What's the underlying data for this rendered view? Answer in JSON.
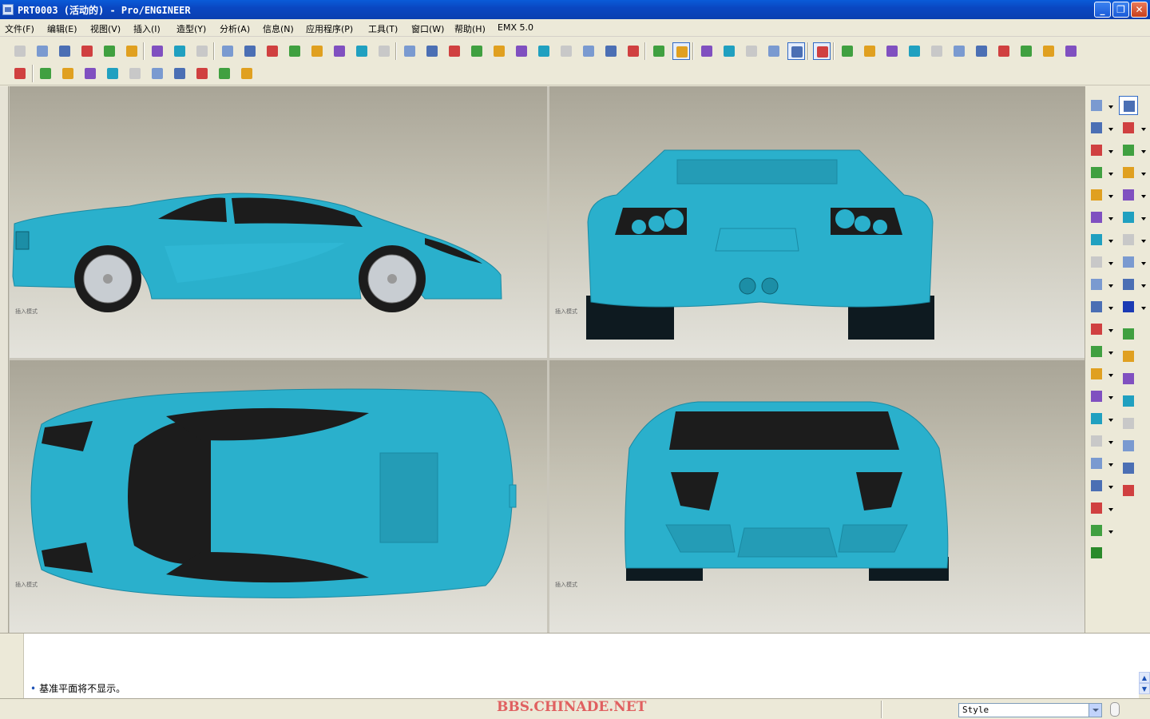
{
  "window": {
    "title": "PRT0003 (活动的) - Pro/ENGINEER",
    "controls": [
      "minimize",
      "maximize",
      "close"
    ]
  },
  "menu": {
    "items": [
      "文件(F)",
      "编辑(E)",
      "视图(V)",
      "插入(I)",
      "造型(Y)",
      "分析(A)",
      "信息(N)",
      "应用程序(P)",
      "工具(T)",
      "窗口(W)",
      "帮助(H)",
      "EMX 5.0"
    ]
  },
  "toolbars": {
    "row1_icons": [
      "new-icon",
      "open-icon",
      "save-icon",
      "print-icon",
      "send-icon",
      "mail-icon",
      "undo-icon",
      "redo-icon",
      "regenerate-icon",
      "cut-icon",
      "copy-icon",
      "paste-icon",
      "paste-special-icon",
      "model-player-icon",
      "find-icon",
      "selection-box-icon",
      "repaint-icon",
      "spin-center-icon",
      "orient-icon",
      "zoom-in-icon",
      "zoom-out-icon",
      "refit-icon",
      "reorient-icon",
      "saved-views-icon",
      "layers-icon",
      "view-manager-icon",
      "wireframe-icon",
      "hidden-line-icon",
      "no-hidden-icon",
      "shading-icon",
      "datum-planes-icon",
      "datum-axes-icon",
      "datum-points-icon",
      "coordinate-systems-icon",
      "annotation-icon",
      "four-view-icon",
      "curvature-icon",
      "section-icon",
      "offset-icon",
      "reflection-icon",
      "shade-analysis-icon",
      "draft-icon",
      "slope-icon",
      "dihedral-icon",
      "curve-analysis-icon",
      "delete-analysis-icon",
      "saved-analysis-icon"
    ],
    "row2_icons": [
      "context-help-icon",
      "measure-icon",
      "geometry-icon",
      "model-analysis-icon",
      "curve-icon",
      "surface-analysis-icon",
      "deviation-icon",
      "color-map-icon",
      "draft-check-icon",
      "graph-icon",
      "diagnose-icon"
    ]
  },
  "viewports": [
    {
      "name": "side-view",
      "label": "插入模式"
    },
    {
      "name": "rear-view",
      "label": "插入模式"
    },
    {
      "name": "top-view",
      "label": "插入模式"
    },
    {
      "name": "front-view",
      "label": "插入模式"
    }
  ],
  "right_toolbar": {
    "left_column": [
      "extrude-icon",
      "revolve-icon",
      "hole-icon",
      "shell-icon",
      "rib-icon",
      "round-icon",
      "chamfer-icon",
      "draft-tool-icon",
      "pattern-icon",
      "mirror-icon",
      "merge-icon",
      "trim-icon",
      "extend-icon",
      "offset-tool-icon",
      "thicken-icon",
      "solidify-icon",
      "project-icon",
      "intersect-icon",
      "wrap-icon",
      "style-icon",
      "emx-icon"
    ],
    "right_column": [
      "select-arrow-icon",
      "plane-icon",
      "curve-icon",
      "sketch-icon",
      "boundary-icon",
      "fill-icon",
      "blend-icon",
      "sweep-icon",
      "vst-icon",
      "done-check-icon",
      "sketched-curve-icon",
      "datum-plane-icon",
      "datum-axis-icon",
      "datum-curve-icon",
      "datum-point-icon",
      "datum-point-sketched-icon",
      "offset-point-icon",
      "chain-icon"
    ]
  },
  "message": {
    "bullet": "•",
    "text": "基准平面将不显示。"
  },
  "status": {
    "watermark": "BBS.CHINADE.NET",
    "filter_value": "Style"
  },
  "colors": {
    "car_body": "#2ab0cc",
    "car_dark": "#1c1c1c",
    "title_bar": "#0a47c2",
    "watermark": "#e06060"
  }
}
